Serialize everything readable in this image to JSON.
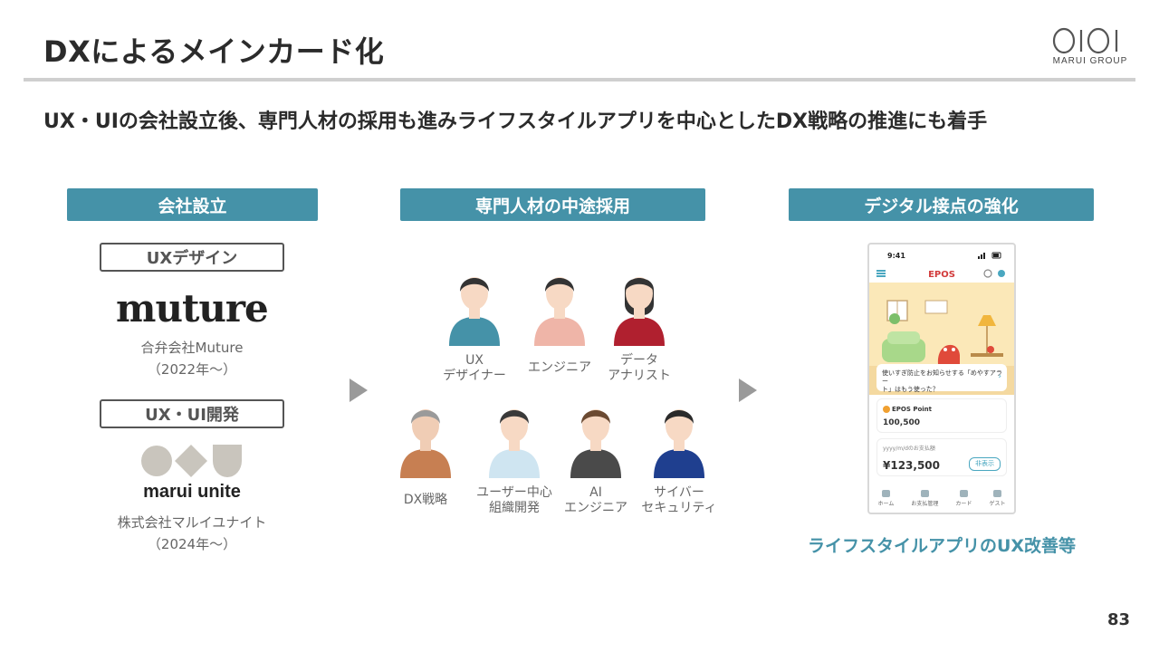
{
  "title": "DXによるメインカード化",
  "logo": {
    "brand": "MARUI GROUP"
  },
  "subtitle": "UX・UIの会社設立後、専門人材の採用も進みライフスタイルアプリを中心としたDX戦略の推進にも着手",
  "columns": {
    "left": {
      "header": "会社設立",
      "companies": [
        {
          "tag": "UXデザイン",
          "wordmark": "muture",
          "name": "合弁会社Muture",
          "since": "（2022年～）"
        },
        {
          "tag": "UX・UI開発",
          "wordmark": "marui unite",
          "name": "株式会社マルイユナイト",
          "since": "（2024年～）"
        }
      ]
    },
    "middle": {
      "header": "専門人材の中途採用",
      "roles": [
        {
          "line1": "UX",
          "line2": "デザイナー",
          "shirt": "#4592a8",
          "skin": "#f7d9c4",
          "hair": "#333333"
        },
        {
          "line1": "エンジニア",
          "line2": "",
          "shirt": "#efb5a8",
          "skin": "#f7d9c4",
          "hair": "#333333"
        },
        {
          "line1": "データ",
          "line2": "アナリスト",
          "shirt": "#b0202f",
          "skin": "#f7d9c4",
          "hair": "#333333"
        },
        {
          "line1": "DX戦略",
          "line2": "",
          "shirt": "#c77f52",
          "skin": "#f0cdb5",
          "hair": "#9a9a9a"
        },
        {
          "line1": "ユーザー中心",
          "line2": "組織開発",
          "shirt": "#cfe5f1",
          "skin": "#f7d9c4",
          "hair": "#3a3a3a"
        },
        {
          "line1": "AI",
          "line2": "エンジニア",
          "shirt": "#4a4a4a",
          "skin": "#f7d9c4",
          "hair": "#6b4a32"
        },
        {
          "line1": "サイバー",
          "line2": "セキュリティ",
          "shirt": "#1f3f8f",
          "skin": "#f7d9c4",
          "hair": "#2a2a2a"
        }
      ]
    },
    "right": {
      "header": "デジタル接点の強化",
      "phone": {
        "time": "9:41",
        "app": "EPOS",
        "notice_line1": "使いすぎ防止をお知らせする「めやすアラー",
        "notice_line2": "ト」はもう使った？",
        "point_label": "EPOS Point",
        "point_value": "100,500",
        "balance_date": "yyyy/m/dのお支払額",
        "balance_value": "¥123,500",
        "hide_button": "非表示",
        "nav": [
          "ホーム",
          "お支払管理",
          "カード",
          "ゲスト"
        ]
      },
      "caption": "ライフスタイルアプリのUX改善等"
    }
  },
  "colors": {
    "accent": "#4592a8",
    "arrow": "#9a9a9a"
  },
  "page_number": "83"
}
